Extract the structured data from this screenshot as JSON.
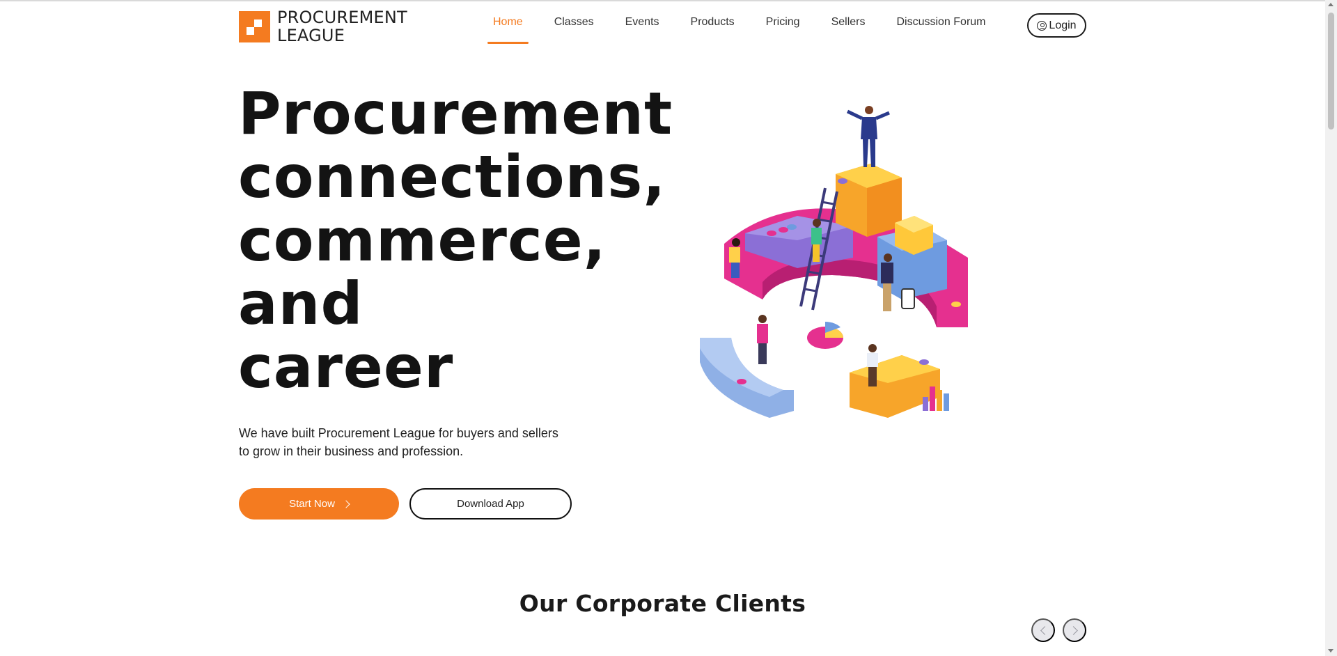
{
  "brand": {
    "line1": "PROCUREMENT",
    "line2": "LEAGUE",
    "accent_color": "#f47b20",
    "logo_icon": "procurement-league-logo-icon"
  },
  "nav": {
    "items": [
      {
        "label": "Home",
        "active": true
      },
      {
        "label": "Classes"
      },
      {
        "label": "Events"
      },
      {
        "label": "Products"
      },
      {
        "label": "Pricing"
      },
      {
        "label": "Sellers"
      },
      {
        "label": "Discussion Forum"
      }
    ],
    "login_label": "Login",
    "login_icon": "user-circle-icon"
  },
  "hero": {
    "title_lines": [
      "Procurement",
      "connections,",
      "commerce,",
      "and",
      "career"
    ],
    "subtitle": "We have built Procurement League for buyers and sellers to grow in their business and profession.",
    "primary_button": "Start Now",
    "primary_button_icon": "chevron-right-icon",
    "secondary_button": "Download App",
    "illustration": "isometric-business-team-illustration"
  },
  "clients": {
    "title": "Our Corporate Clients",
    "prev_icon": "chevron-left-icon",
    "next_icon": "chevron-right-icon"
  }
}
